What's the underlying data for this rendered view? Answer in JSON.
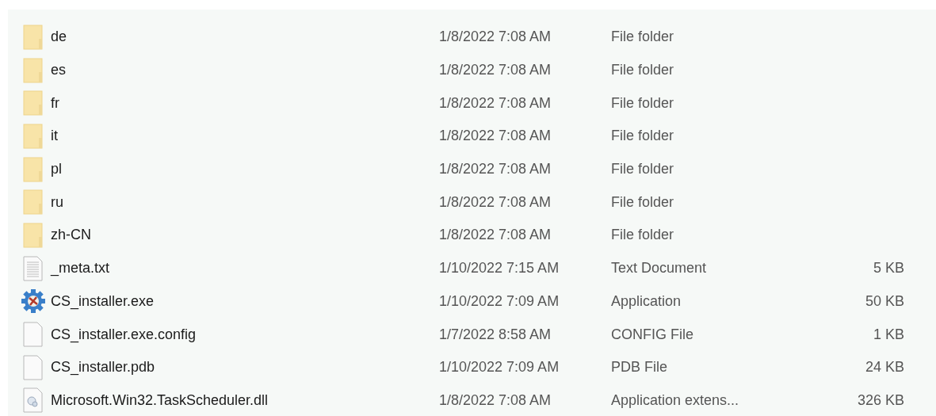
{
  "files": [
    {
      "kind": "folder",
      "name": "de",
      "date": "1/8/2022 7:08 AM",
      "type": "File folder"
    },
    {
      "kind": "folder",
      "name": "es",
      "date": "1/8/2022 7:08 AM",
      "type": "File folder"
    },
    {
      "kind": "folder",
      "name": "fr",
      "date": "1/8/2022 7:08 AM",
      "type": "File folder"
    },
    {
      "kind": "folder",
      "name": "it",
      "date": "1/8/2022 7:08 AM",
      "type": "File folder"
    },
    {
      "kind": "folder",
      "name": "pl",
      "date": "1/8/2022 7:08 AM",
      "type": "File folder"
    },
    {
      "kind": "folder",
      "name": "ru",
      "date": "1/8/2022 7:08 AM",
      "type": "File folder"
    },
    {
      "kind": "folder",
      "name": "zh-CN",
      "date": "1/8/2022 7:08 AM",
      "type": "File folder"
    },
    {
      "kind": "text",
      "name": "_meta.txt",
      "date": "1/10/2022 7:15 AM",
      "type": "Text Document",
      "size": "5 KB"
    },
    {
      "kind": "app",
      "name": "CS_installer.exe",
      "date": "1/10/2022 7:09 AM",
      "type": "Application",
      "size": "50 KB"
    },
    {
      "kind": "blank",
      "name": "CS_installer.exe.config",
      "date": "1/7/2022 8:58 AM",
      "type": "CONFIG File",
      "size": "1 KB"
    },
    {
      "kind": "blank",
      "name": "CS_installer.pdb",
      "date": "1/10/2022 7:09 AM",
      "type": "PDB File",
      "size": "24 KB"
    },
    {
      "kind": "dll",
      "name": "Microsoft.Win32.TaskScheduler.dll",
      "date": "1/8/2022 7:08 AM",
      "type": "Application extens...",
      "size": "326 KB"
    }
  ]
}
